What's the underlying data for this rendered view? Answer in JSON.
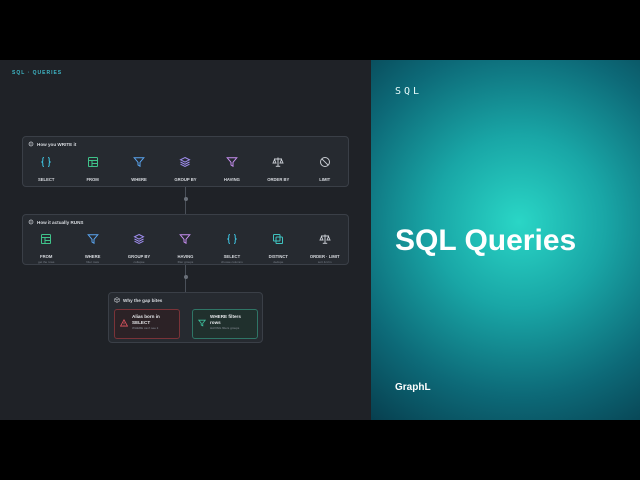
{
  "breadcrumb": "SQL · QUERIES",
  "written": {
    "title": "How you WRITE it",
    "items": [
      {
        "label": "SELECT",
        "icon": "braces-icon",
        "color": "#3fc3e0"
      },
      {
        "label": "FROM",
        "icon": "table-icon",
        "color": "#3fc38a"
      },
      {
        "label": "WHERE",
        "icon": "filter-icon",
        "color": "#5aa5f0"
      },
      {
        "label": "GROUP BY",
        "icon": "layers-icon",
        "color": "#a08ef0"
      },
      {
        "label": "HAVING",
        "icon": "filter-icon",
        "color": "#c78ef0"
      },
      {
        "label": "ORDER BY",
        "icon": "scale-icon",
        "color": "#c8ccd2"
      },
      {
        "label": "LIMIT",
        "icon": "ban-icon",
        "color": "#c8ccd2"
      }
    ]
  },
  "runs": {
    "title": "How it actually RUNS",
    "items": [
      {
        "label": "FROM",
        "sub": "get the rows",
        "icon": "table-icon",
        "color": "#3fc38a"
      },
      {
        "label": "WHERE",
        "sub": "filter rows",
        "icon": "filter-icon",
        "color": "#5aa5f0"
      },
      {
        "label": "GROUP BY",
        "sub": "collapse",
        "icon": "layers-icon",
        "color": "#a08ef0"
      },
      {
        "label": "HAVING",
        "sub": "filter groups",
        "icon": "filter-icon",
        "color": "#c78ef0"
      },
      {
        "label": "SELECT",
        "sub": "choose columns",
        "icon": "braces-icon",
        "color": "#3fc3e0"
      },
      {
        "label": "DISTINCT",
        "sub": "dedupe",
        "icon": "copy-icon",
        "color": "#3fc3c0"
      },
      {
        "label": "ORDER · LIMIT",
        "sub": "sort & trim",
        "icon": "scale-icon",
        "color": "#c8ccd2"
      }
    ]
  },
  "gap": {
    "title": "Why the gap bites",
    "warning": {
      "title": "Alias born in SELECT",
      "sub": "WHERE can't see it",
      "color": "#e25560"
    },
    "info": {
      "title": "WHERE filters rows",
      "sub": "HAVING filters groups",
      "color": "#3fc3a0"
    }
  },
  "hero": {
    "tag": "SQL",
    "title": "SQL Queries",
    "brand": "GraphL"
  }
}
